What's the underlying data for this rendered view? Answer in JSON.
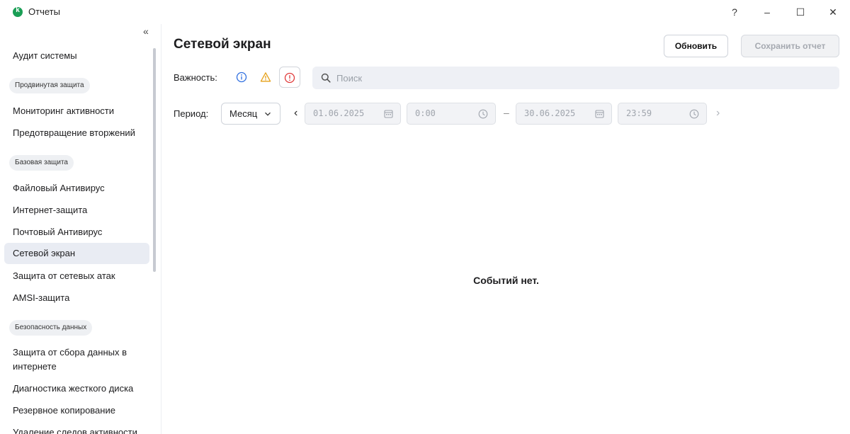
{
  "window": {
    "title": "Отчеты",
    "help": "?",
    "minimize": "–",
    "maximize": "☐",
    "close": "✕"
  },
  "sidebar": {
    "collapse_glyph": "«",
    "items": [
      {
        "label": "Аудит системы"
      },
      {
        "group": "Продвинутая защита"
      },
      {
        "label": "Мониторинг активности"
      },
      {
        "label": "Предотвращение вторжений"
      },
      {
        "group": "Базовая защита"
      },
      {
        "label": "Файловый Антивирус"
      },
      {
        "label": "Интернет-защита"
      },
      {
        "label": "Почтовый Антивирус"
      },
      {
        "label": "Сетевой экран",
        "active": true
      },
      {
        "label": "Защита от сетевых атак"
      },
      {
        "label": "AMSI-защита"
      },
      {
        "group": "Безопасность данных"
      },
      {
        "label": "Защита от сбора данных в интернете"
      },
      {
        "label": "Диагностика жесткого диска"
      },
      {
        "label": "Резервное копирование"
      },
      {
        "label": "Удаление следов активности"
      }
    ]
  },
  "main": {
    "title": "Сетевой экран",
    "refresh_label": "Обновить",
    "save_label": "Сохранить отчет",
    "severity_label": "Важность:",
    "severity": {
      "info_color": "#2f6fe0",
      "warning_color": "#e6a11a",
      "critical_color": "#e03a3a",
      "selected": "critical"
    },
    "search": {
      "placeholder": "Поиск",
      "value": ""
    },
    "period_label": "Период:",
    "period_value": "Месяц",
    "prev_glyph": "‹",
    "next_glyph": "›",
    "date_from": "01.06.2025",
    "time_from": "0:00",
    "range_dash": "–",
    "date_to": "30.06.2025",
    "time_to": "23:59",
    "empty_message": "Событий нет."
  }
}
